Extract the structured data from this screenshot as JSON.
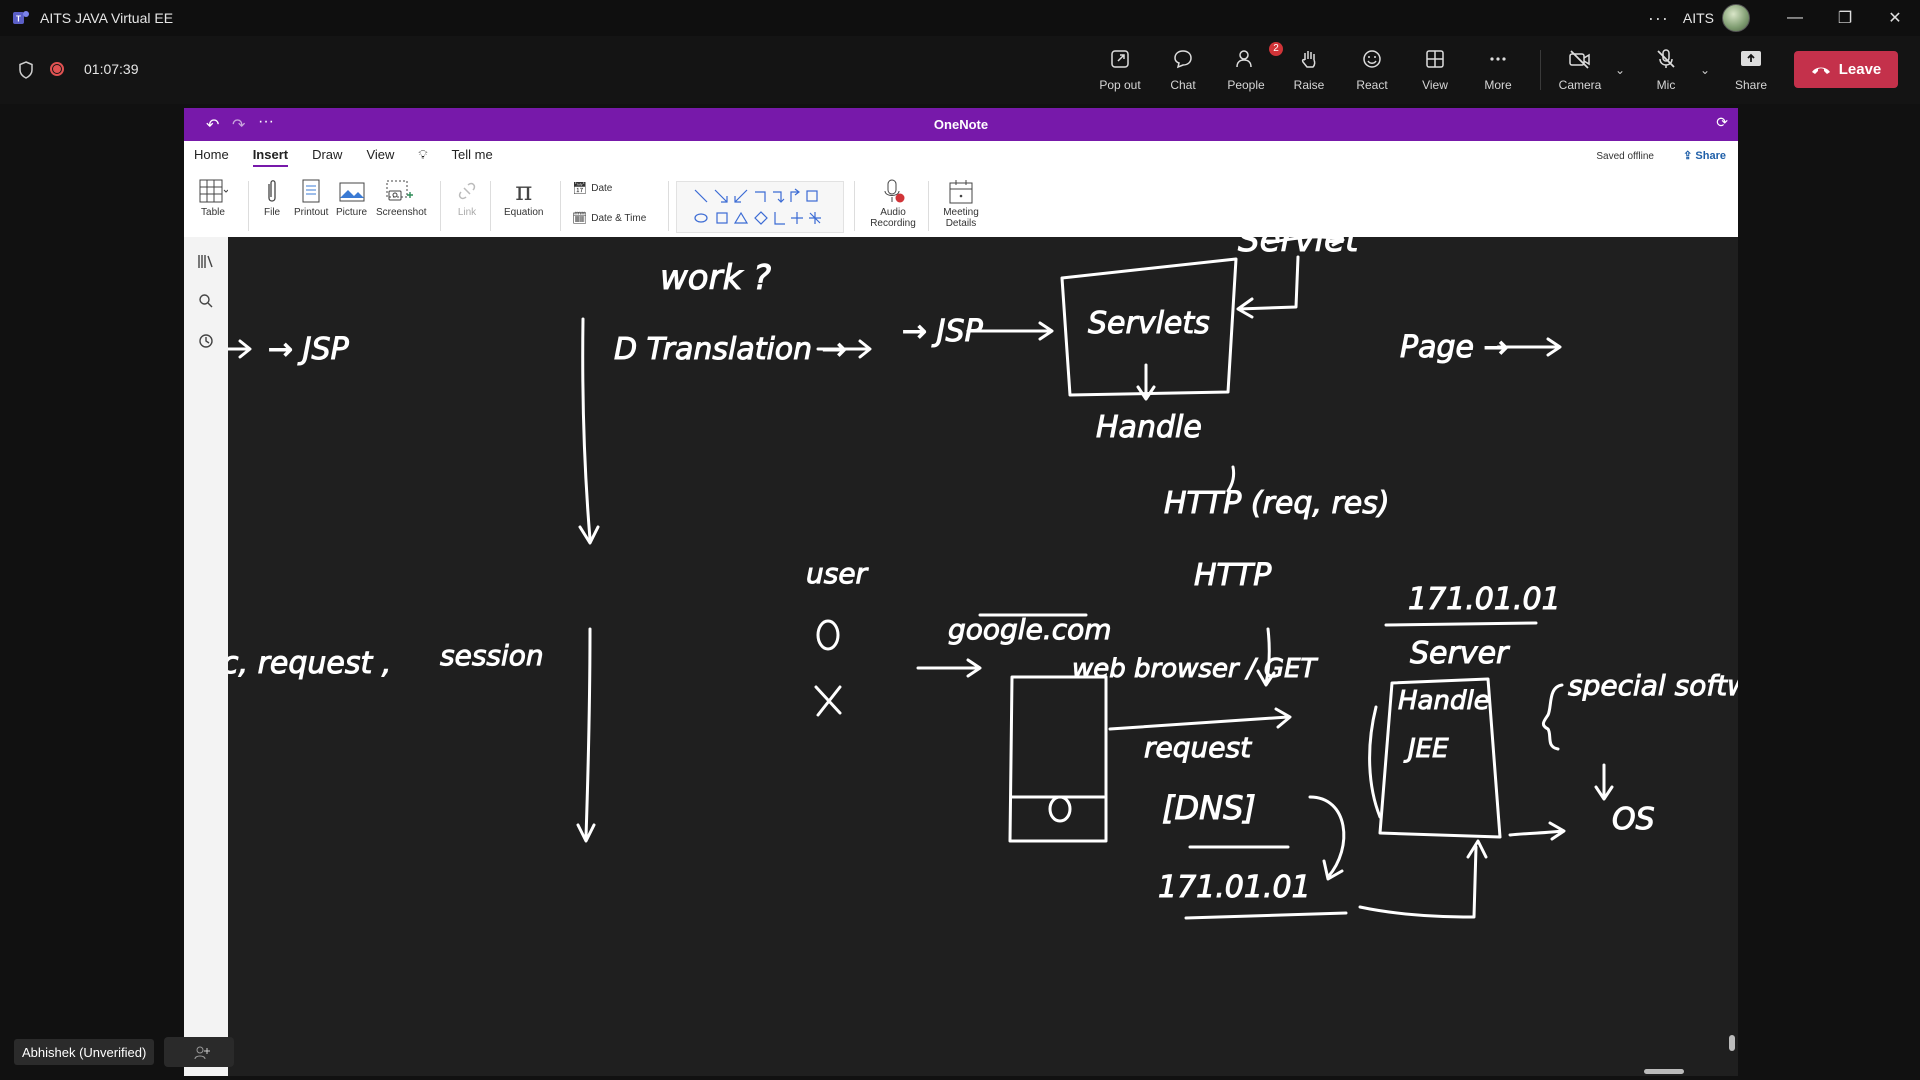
{
  "window": {
    "title": "AITS JAVA Virtual EE",
    "user": "AITS",
    "more": "···"
  },
  "meeting": {
    "timer": "01:07:39",
    "buttons": {
      "popout": "Pop out",
      "chat": "Chat",
      "people": "People",
      "people_badge": "2",
      "raise": "Raise",
      "react": "React",
      "view": "View",
      "more": "More",
      "camera": "Camera",
      "mic": "Mic",
      "share": "Share",
      "leave": "Leave"
    }
  },
  "onenote": {
    "title": "OneNote",
    "tabs": [
      "Home",
      "Insert",
      "Draw",
      "View",
      "Tell me"
    ],
    "ribbon": {
      "table": "Table",
      "file": "File",
      "printout": "Printout",
      "picture": "Picture",
      "screenshot": "Screenshot",
      "link": "Link",
      "equation": "Equation",
      "date": "Date",
      "date_time": "Date & Time",
      "audio": "Audio Recording",
      "meeting": "Meeting Details"
    },
    "saved": "Saved offline",
    "share": "Share"
  },
  "ink": {
    "t1": "Servlet",
    "t2": "work ?",
    "t3": "→ JSP",
    "t4": "D Translation →",
    "t5": "→ JSP",
    "t6": "Servlets",
    "t7": "Page →",
    "t8": "Handle",
    "t9": "HTTP (req, res)",
    "t10": "user",
    "t11": "google.com",
    "t12": "HTTP",
    "t13": "171.01.01",
    "t14": "Server",
    "t15": "web browser / GET",
    "t16": "request",
    "t17": "Handle",
    "t18": "JEE",
    "t19": "special software",
    "t20": "OS",
    "t21": "[DNS]",
    "t22": "171.01.01",
    "t23": "c, request ,",
    "t24": "session"
  },
  "participant": {
    "name": "Abhishek (Unverified)"
  }
}
